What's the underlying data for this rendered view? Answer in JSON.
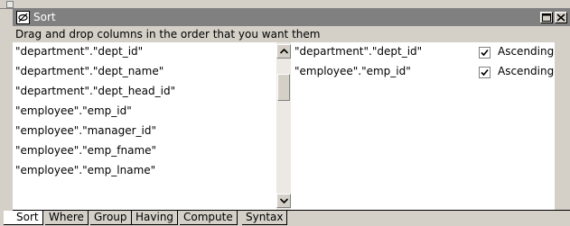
{
  "window": {
    "title": "Sort",
    "hint": "Drag and drop columns in the order that you want them"
  },
  "source_columns": [
    "\"department\".\"dept_id\"",
    "\"department\".\"dept_name\"",
    "\"department\".\"dept_head_id\"",
    "\"employee\".\"emp_id\"",
    "\"employee\".\"manager_id\"",
    "\"employee\".\"emp_fname\"",
    "\"employee\".\"emp_lname\""
  ],
  "sort_columns": [
    {
      "name": "\"department\".\"dept_id\"",
      "ascending_label": "Ascending",
      "checked": true
    },
    {
      "name": "\"employee\".\"emp_id\"",
      "ascending_label": "Ascending",
      "checked": true
    }
  ],
  "tabs": [
    "Sort",
    "Where",
    "Group",
    "Having",
    "Compute",
    "Syntax"
  ],
  "active_tab": "Sort"
}
